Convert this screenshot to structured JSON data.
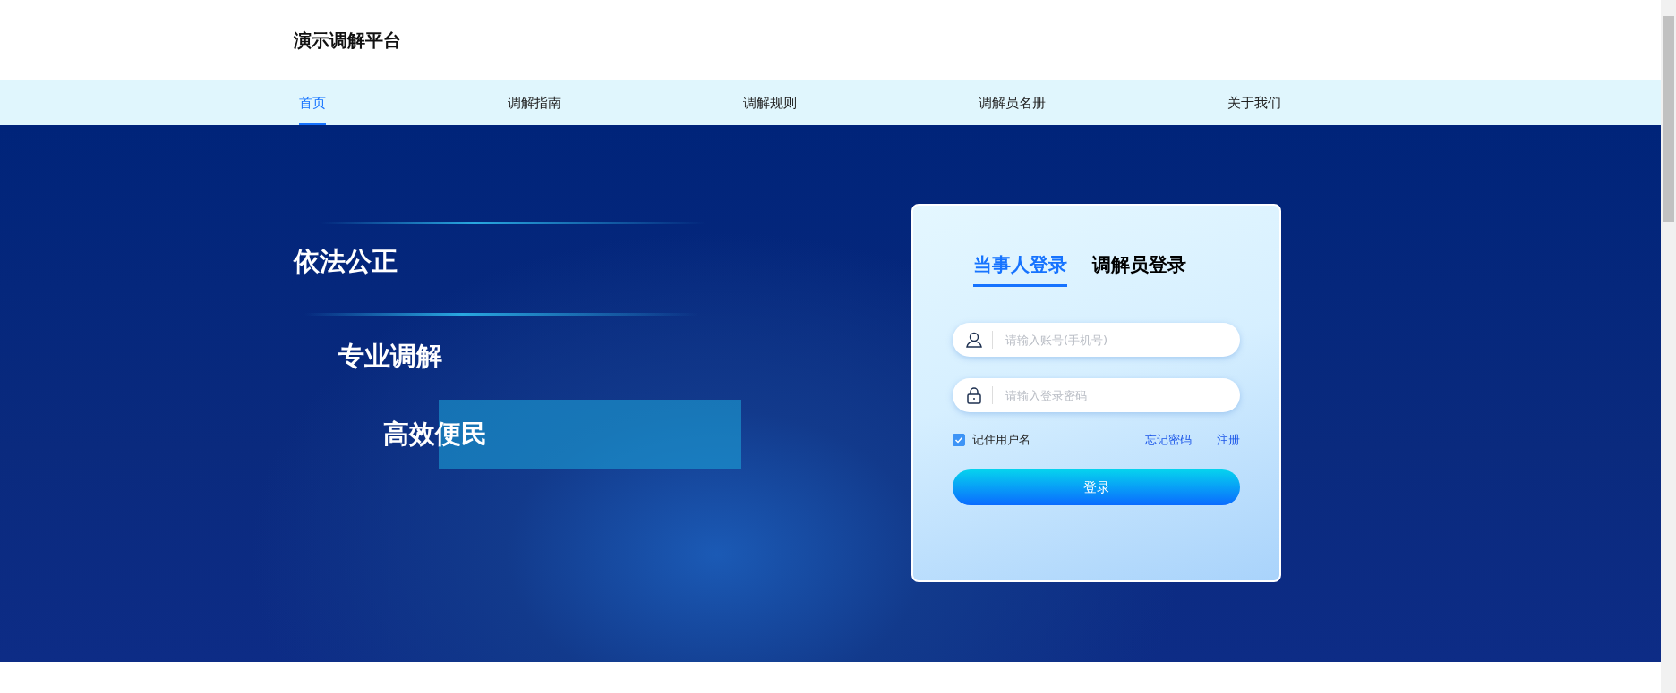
{
  "header": {
    "site_title": "演示调解平台"
  },
  "nav": [
    {
      "label": "首页",
      "selected": true
    },
    {
      "label": "调解指南",
      "selected": false
    },
    {
      "label": "调解规则",
      "selected": false
    },
    {
      "label": "调解员名册",
      "selected": false
    },
    {
      "label": "关于我们",
      "selected": false
    }
  ],
  "hero": {
    "slogans": [
      {
        "text": "依法公正",
        "highlighted": false
      },
      {
        "text": "专业调解",
        "highlighted": false
      },
      {
        "text": "高效便民",
        "highlighted": true
      }
    ]
  },
  "login": {
    "tabs": [
      {
        "label": "当事人登录",
        "selected": true
      },
      {
        "label": "调解员登录",
        "selected": false
      }
    ],
    "fields": [
      {
        "kind": "user",
        "placeholder": "请输入账号(手机号)"
      },
      {
        "kind": "lock",
        "placeholder": "请输入登录密码"
      }
    ],
    "remember": {
      "label": "记住用户名",
      "checked": true
    },
    "links": [
      "忘记密码",
      "注册"
    ],
    "submit": "登录"
  }
}
